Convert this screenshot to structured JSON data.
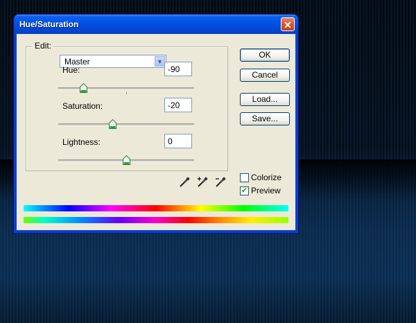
{
  "window": {
    "title": "Hue/Saturation",
    "close_glyph": "✕"
  },
  "edit": {
    "label": "Edit:",
    "selected": "Master"
  },
  "adjustments": {
    "hue": {
      "label": "Hue:",
      "value": "-90",
      "fraction": 0.185
    },
    "saturation": {
      "label": "Saturation:",
      "value": "-20",
      "fraction": 0.4
    },
    "lightness": {
      "label": "Lightness:",
      "value": "0",
      "fraction": 0.5
    }
  },
  "buttons": {
    "ok": "OK",
    "cancel": "Cancel",
    "load": "Load...",
    "save": "Save..."
  },
  "options": {
    "colorize": {
      "label": "Colorize",
      "checked": false
    },
    "preview": {
      "label": "Preview",
      "checked": true
    }
  },
  "icons": {
    "eyedropper": "eyedropper-icon",
    "eyedropper_add": "eyedropper-plus-icon",
    "eyedropper_subtract": "eyedropper-minus-icon",
    "check": "✔"
  },
  "colors": {
    "titlebar": "#0454e3",
    "dialog_bg": "#ece9d8",
    "close_button": "#d9592f",
    "thumb_green": "#2f9e3f"
  }
}
